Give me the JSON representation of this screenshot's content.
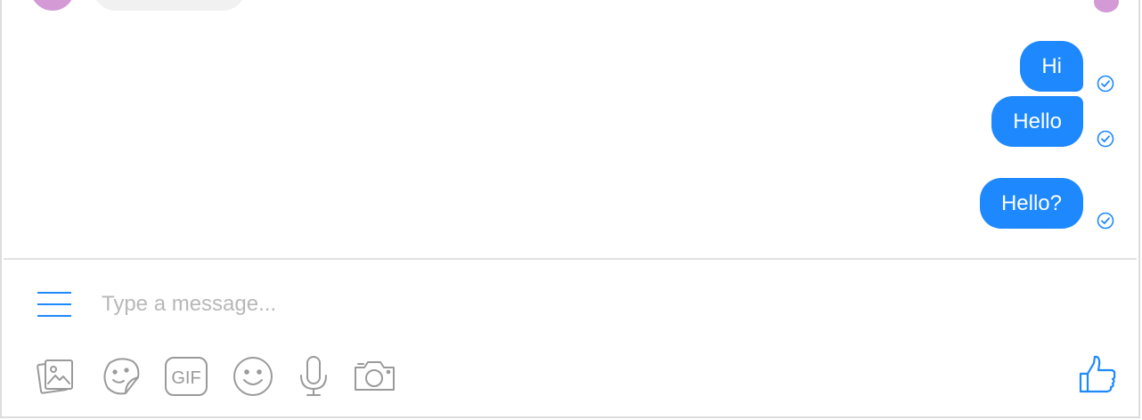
{
  "conversation": {
    "messages": [
      {
        "text": "Hi",
        "status_icon": "check-circle-icon"
      },
      {
        "text": "Hello",
        "status_icon": "check-circle-icon"
      },
      {
        "text": "Hello?",
        "status_icon": "check-circle-icon"
      }
    ]
  },
  "composer": {
    "placeholder": "Type a message...",
    "menu_icon": "hamburger-menu-icon",
    "tools": [
      "image-icon",
      "sticker-icon",
      "gif-icon",
      "emoji-icon",
      "microphone-icon",
      "camera-icon"
    ],
    "gif_label": "GIF",
    "send_icon": "thumbs-up-icon"
  },
  "colors": {
    "accent": "#1e88ff",
    "outgoing_bubble": "#1e88ff",
    "incoming_bubble": "#f1f1f1",
    "avatar": "#d39ad6",
    "tool_gray": "#9a9a9a"
  }
}
